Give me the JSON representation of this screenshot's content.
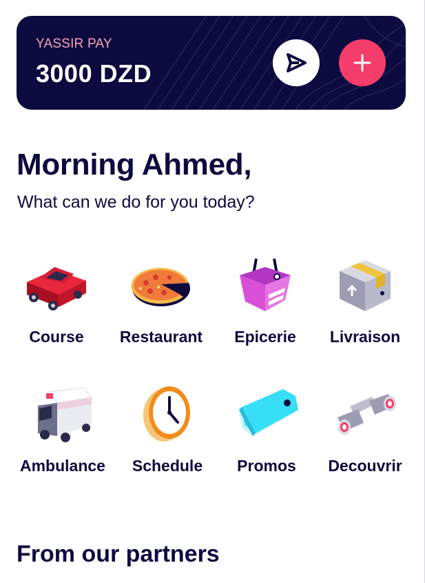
{
  "wallet": {
    "label": "YASSIR PAY",
    "balance": "3000 DZD",
    "send_icon": "send-icon",
    "add_icon": "plus-icon",
    "colors": {
      "card_background": "#0c0a3e",
      "label": "#f7a6b7",
      "add_button": "#f53d6b"
    }
  },
  "greeting": {
    "title": "Morning Ahmed,",
    "subtitle": "What can we do for you today?"
  },
  "services": [
    {
      "label": "Course",
      "icon": "car-icon"
    },
    {
      "label": "Restaurant",
      "icon": "pizza-icon"
    },
    {
      "label": "Epicerie",
      "icon": "basket-icon"
    },
    {
      "label": "Livraison",
      "icon": "package-icon"
    },
    {
      "label": "Ambulance",
      "icon": "ambulance-icon"
    },
    {
      "label": "Schedule",
      "icon": "clock-icon"
    },
    {
      "label": "Promos",
      "icon": "tag-icon"
    },
    {
      "label": "Decouvrir",
      "icon": "binoculars-icon"
    }
  ],
  "partners": {
    "title": "From our partners"
  }
}
